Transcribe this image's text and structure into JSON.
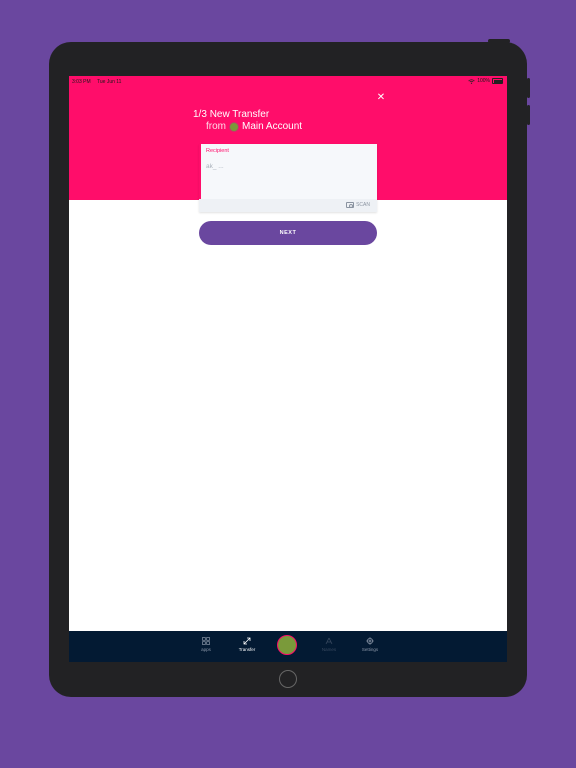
{
  "status_bar": {
    "time": "3:03 PM",
    "date": "Tue Jun 11",
    "battery": "100%"
  },
  "header": {
    "step": "1/3",
    "title": "New Transfer",
    "from_label": "from",
    "account_name": "Main Account"
  },
  "recipient": {
    "label": "Recipient",
    "placeholder": "ak_ ..."
  },
  "scan_label": "SCAN",
  "next_label": "NEXT",
  "tabs": [
    {
      "label": "apps",
      "icon": "grid-icon"
    },
    {
      "label": "Transfer",
      "icon": "transfer-icon"
    },
    {
      "label": "",
      "icon": "account-avatar"
    },
    {
      "label": "Names",
      "icon": "names-icon"
    },
    {
      "label": "Settings",
      "icon": "gear-icon"
    }
  ],
  "colors": {
    "brand_pink": "#ff0d6a",
    "purple": "#6a479f",
    "tabbar": "#031a33"
  }
}
